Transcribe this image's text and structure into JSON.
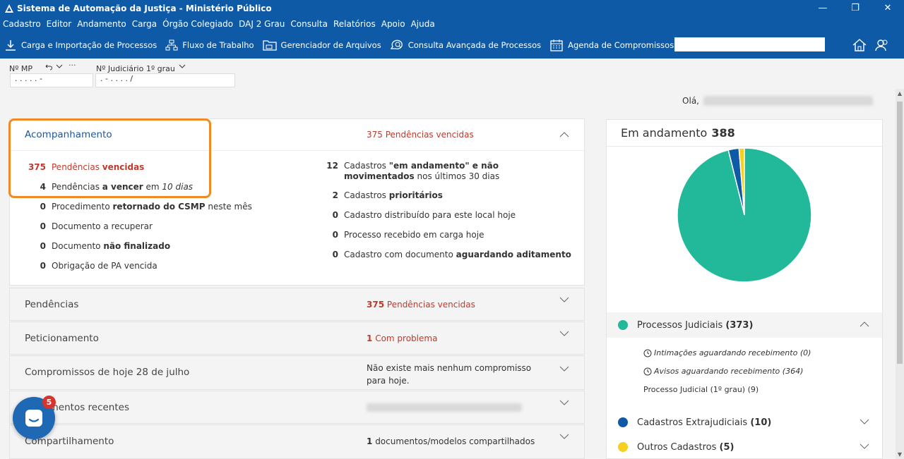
{
  "window": {
    "title": "Sistema de Automação da Justiça - Ministério Público",
    "minimize": "—",
    "restore": "❐",
    "close": "✕"
  },
  "menu": [
    "Cadastro",
    "Editor",
    "Andamento",
    "Carga",
    "Órgão Colegiado",
    "DAJ 2 Grau",
    "Consulta",
    "Relatórios",
    "Apoio",
    "Ajuda"
  ],
  "toolbar": {
    "items": [
      "Carga e Importação de Processos",
      "Fluxo de Trabalho",
      "Gerenciador de Arquivos",
      "Consulta Avançada de Processos",
      "Agenda de Compromissos"
    ],
    "search_value": ""
  },
  "filters": {
    "mp_label": "Nº MP",
    "mp_value": ". . . . . -",
    "jud_label": "Nº Judiciário",
    "grau": "1º grau",
    "jud_value": ". - . . . . /"
  },
  "greeting": "Olá,",
  "acompanhamento": {
    "title": "Acompanhamento",
    "summary_num": "375",
    "summary_text": "Pendências vencidas",
    "left": [
      {
        "num": "375",
        "pre": "Pendências ",
        "bold": "vencidas",
        "post": "",
        "red": true
      },
      {
        "num": "4",
        "pre": "Pendências ",
        "bold": "a vencer",
        "post": " em ",
        "italic": "10 dias"
      },
      {
        "num": "0",
        "pre": "Procedimento ",
        "bold": "retornado do CSMP",
        "post": " neste mês"
      },
      {
        "num": "0",
        "pre": "Documento a recuperar",
        "bold": "",
        "post": ""
      },
      {
        "num": "0",
        "pre": "Documento ",
        "bold": "não finalizado",
        "post": ""
      },
      {
        "num": "0",
        "pre": "Obrigação de PA vencida",
        "bold": "",
        "post": ""
      }
    ],
    "right": [
      {
        "num": "12",
        "pre": "Cadastros ",
        "bold": "\"em andamento\" e não movimentados",
        "post": " nos últimos 30 dias"
      },
      {
        "num": "2",
        "pre": "Cadastros ",
        "bold": "prioritários",
        "post": ""
      },
      {
        "num": "0",
        "pre": "Cadastro distribuído para este local hoje",
        "bold": "",
        "post": ""
      },
      {
        "num": "0",
        "pre": "Processo recebido em carga hoje",
        "bold": "",
        "post": ""
      },
      {
        "num": "0",
        "pre": "Cadastro com documento ",
        "bold": "aguardando aditamento",
        "post": ""
      }
    ]
  },
  "sections": [
    {
      "title": "Pendências",
      "num": "375",
      "info": "Pendências vencidas",
      "red": true
    },
    {
      "title": "Peticionamento",
      "num": "1",
      "info": "Com problema",
      "red": true
    },
    {
      "title": "Compromissos de hoje 28 de julho",
      "info": "Não existe mais nenhum compromisso para hoje."
    },
    {
      "title": "Documentos recentes",
      "info": ""
    },
    {
      "title": "Compartilhamento",
      "num": "1",
      "info": "documentos/modelos compartilhados"
    }
  ],
  "right_panel": {
    "title": "Em andamento",
    "total": "388",
    "legend": [
      {
        "label": "Processos Judiciais",
        "count": "(373)",
        "color": "#22b99a"
      },
      {
        "label": "Cadastros Extrajudiciais",
        "count": "(10)",
        "color": "#0f5aa6"
      },
      {
        "label": "Outros Cadastros",
        "count": "(5)",
        "color": "#f5d020"
      }
    ],
    "sub_items": [
      {
        "text": "Intimações aguardando recebimento (0)",
        "icon": "clock-icon"
      },
      {
        "text": "Avisos aguardando recebimento (364)",
        "icon": "clock-icon"
      },
      {
        "text": "Processo Judicial (1º grau) (9)"
      }
    ]
  },
  "chart_data": {
    "type": "pie",
    "categories": [
      "Processos Judiciais",
      "Cadastros Extrajudiciais",
      "Outros Cadastros"
    ],
    "values": [
      373,
      10,
      5
    ],
    "colors": [
      "#22b99a",
      "#0f5aa6",
      "#f5d020"
    ],
    "title": ""
  },
  "chat": {
    "badge": "5"
  }
}
